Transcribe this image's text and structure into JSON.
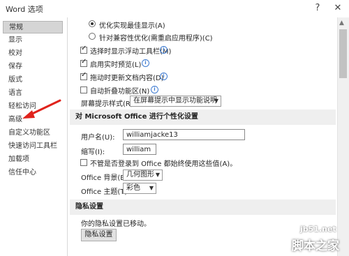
{
  "window": {
    "title": "Word 选项",
    "help": "?",
    "close": "✕"
  },
  "sidebar": {
    "items": [
      {
        "label": "常规"
      },
      {
        "label": "显示"
      },
      {
        "label": "校对"
      },
      {
        "label": "保存"
      },
      {
        "label": "版式"
      },
      {
        "label": "语言"
      },
      {
        "label": "轻松访问"
      },
      {
        "label": "高级"
      },
      {
        "label": "自定义功能区"
      },
      {
        "label": "快速访问工具栏"
      },
      {
        "label": "加载项"
      },
      {
        "label": "信任中心"
      }
    ]
  },
  "ui_options": {
    "radio_best_display": "优化实现最佳显示(A)",
    "radio_compat": "针对兼容性优化(需重启应用程序)(C)",
    "show_mini_toolbar": "选择时显示浮动工具栏(M)",
    "live_preview": "启用实时预览(L)",
    "update_while_drag": "拖动时更新文档内容(D)",
    "collapse_ribbon": "自动折叠功能区(N)",
    "screentip_label": "屏幕提示样式(R):",
    "screentip_value": "在屏幕提示中显示功能说明"
  },
  "personalize": {
    "header": "对 Microsoft Office 进行个性化设置",
    "username_label": "用户名(U):",
    "username_value": "williamjacke13",
    "initials_label": "缩写(I):",
    "initials_value": "william",
    "always_use_label": "不管是否登录到 Office 都始终使用这些值(A)。",
    "background_label": "Office 背景(B):",
    "background_value": "几何图形",
    "theme_label": "Office 主题(T):",
    "theme_value": "彩色"
  },
  "privacy": {
    "header": "隐私设置",
    "moved_text": "你的隐私设置已移动。",
    "button": "隐私设置"
  },
  "watermark": {
    "line1": "jb51.net",
    "line2": "脚本之家"
  },
  "colors": {
    "arrow": "#e0231c",
    "active_item": "#d5d5d5",
    "section_bg": "#efefef",
    "info": "#3e7bd1"
  }
}
